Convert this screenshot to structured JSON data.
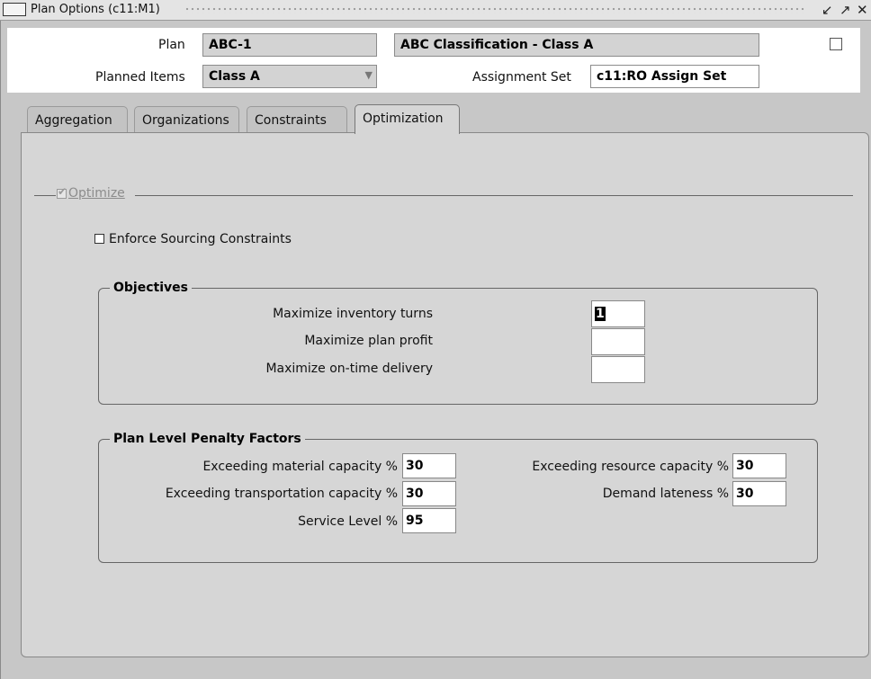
{
  "window": {
    "title": "Plan Options (c11:M1)",
    "icon": "oracle-forms-icon",
    "controls": [
      "minimize-icon",
      "restore-icon",
      "close-icon"
    ]
  },
  "header": {
    "plan_label": "Plan",
    "plan_value": "ABC-1",
    "plan_description": "ABC Classification - Class A",
    "planned_items_label": "Planned Items",
    "planned_items_value": "Class A",
    "assignment_set_label": "Assignment Set",
    "assignment_set_value": "c11:RO Assign Set"
  },
  "tabs": [
    {
      "label": "Aggregation",
      "active": false
    },
    {
      "label": "Organizations",
      "active": false
    },
    {
      "label": "Constraints",
      "active": false
    },
    {
      "label": "Optimization",
      "active": true
    }
  ],
  "optimization": {
    "optimize_label": "Optimize",
    "optimize_checked": true,
    "enforce_label": "Enforce Sourcing Constraints",
    "enforce_checked": false,
    "objectives": {
      "title": "Objectives",
      "rows": [
        {
          "label": "Maximize inventory turns",
          "value": "1"
        },
        {
          "label": "Maximize plan profit",
          "value": ""
        },
        {
          "label": "Maximize on-time delivery",
          "value": ""
        }
      ]
    },
    "penalty": {
      "title": "Plan Level Penalty Factors",
      "material_label": "Exceeding material capacity %",
      "material_value": "30",
      "transport_label": "Exceeding transportation capacity %",
      "transport_value": "30",
      "service_label": "Service Level %",
      "service_value": "95",
      "resource_label": "Exceeding resource capacity %",
      "resource_value": "30",
      "lateness_label": "Demand lateness %",
      "lateness_value": "30"
    }
  },
  "colors": {
    "panel": "#d6d6d6",
    "window": "#c7c7c7",
    "header": "#ffffff"
  }
}
